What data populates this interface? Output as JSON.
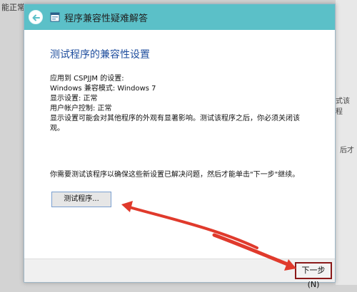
{
  "background": {
    "left_fragment": "能正常",
    "right_fragment_1": "式该程",
    "right_fragment_2": "后才"
  },
  "dialog": {
    "title": "程序兼容性疑难解答",
    "heading": "测试程序的兼容性设置",
    "info": {
      "applied_to": "应用到  CSPJJM 的设置:",
      "compat_mode": "Windows 兼容模式: Windows 7",
      "display": "显示设置:  正常",
      "uac": "用户帐户控制:  正常",
      "note_line1": "显示设置可能会对其他程序的外观有显著影响。测试该程序之后，你必须关闭该",
      "note_line2": "观。"
    },
    "prompt": "你需要测试该程序以确保这些新设置已解决问题，然后才能单击\"下一步\"继续。",
    "test_button_label": "测试程序...",
    "next_button_label": "下一步(N)"
  },
  "colors": {
    "titlebar": "#5bc0c8",
    "heading": "#1f4e9e",
    "annotation_arrow": "#e03a2c",
    "highlight_box": "#8b1a1a"
  }
}
